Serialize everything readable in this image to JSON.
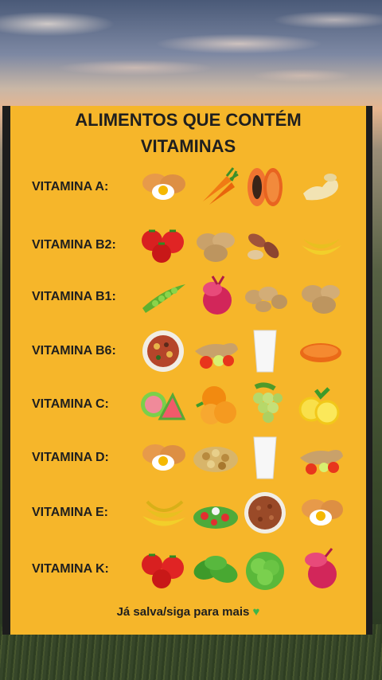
{
  "title_line1": "ALIMENTOS QUE CONTÉM",
  "title_line2": "VITAMINAS",
  "rows": [
    {
      "label": "VITAMINA A:",
      "foods": [
        "eggs",
        "carrots",
        "papaya",
        "ginger"
      ]
    },
    {
      "label": "VITAMINA B2:",
      "foods": [
        "tomatoes",
        "potatoes",
        "peanuts",
        "bananas"
      ]
    },
    {
      "label": "VITAMINA B1:",
      "foods": [
        "peas",
        "beet",
        "potatoes",
        "potatoes"
      ]
    },
    {
      "label": "VITAMINA B6:",
      "foods": [
        "mixed-beans",
        "ginger-tomato",
        "milk",
        "lentils"
      ]
    },
    {
      "label": "VITAMINA C:",
      "foods": [
        "guava-watermelon",
        "orange",
        "grapes",
        "lemons"
      ]
    },
    {
      "label": "VITAMINA D:",
      "foods": [
        "eggs",
        "nuts",
        "milk",
        "ginger-tomato"
      ]
    },
    {
      "label": "VITAMINA E:",
      "foods": [
        "bananas",
        "salad",
        "beans",
        "eggs"
      ]
    },
    {
      "label": "VITAMINA K:",
      "foods": [
        "tomatoes",
        "spinach",
        "lettuce",
        "beet"
      ]
    }
  ],
  "footer": "Já salva/siga para mais",
  "footer_icon": "green-heart-icon"
}
